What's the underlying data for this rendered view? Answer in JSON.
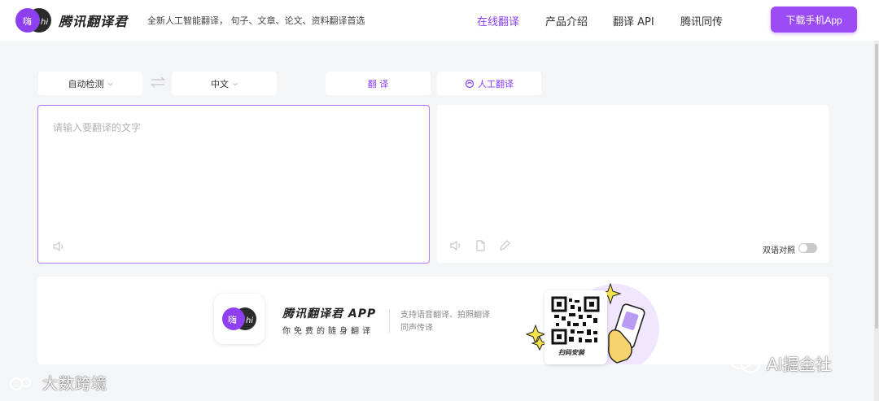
{
  "header": {
    "logo_badge": "嗨hi",
    "brand": "腾讯翻译君",
    "tagline": "全新人工智能翻译， 句子、文章、论文、资料翻译首选",
    "nav": [
      {
        "label": "在线翻译",
        "active": true
      },
      {
        "label": "产品介绍",
        "active": false
      },
      {
        "label": "翻译 API",
        "active": false
      },
      {
        "label": "腾讯同传",
        "active": false
      }
    ],
    "download_button": "下载手机App"
  },
  "toolbar": {
    "source_lang": "自动检测",
    "target_lang": "中文",
    "translate_button": "翻 译",
    "human_translate_button": "人工翻译"
  },
  "source_panel": {
    "placeholder": "请输入要翻译的文字",
    "value": ""
  },
  "target_panel": {
    "bilingual_label": "双语对照",
    "bilingual_enabled": false
  },
  "banner": {
    "app_title": "腾讯翻译君 APP",
    "app_subtitle": "你免费的随身翻译",
    "features_line1": "支持语音翻译、拍照翻译",
    "features_line2": "同声传译",
    "qr_caption": "扫码安装"
  },
  "watermarks": {
    "left": "大数跨境",
    "right": "AI掘金社"
  },
  "colors": {
    "accent": "#8a3ffc",
    "button": "#9b4cf5",
    "background": "#f4f5f7"
  }
}
